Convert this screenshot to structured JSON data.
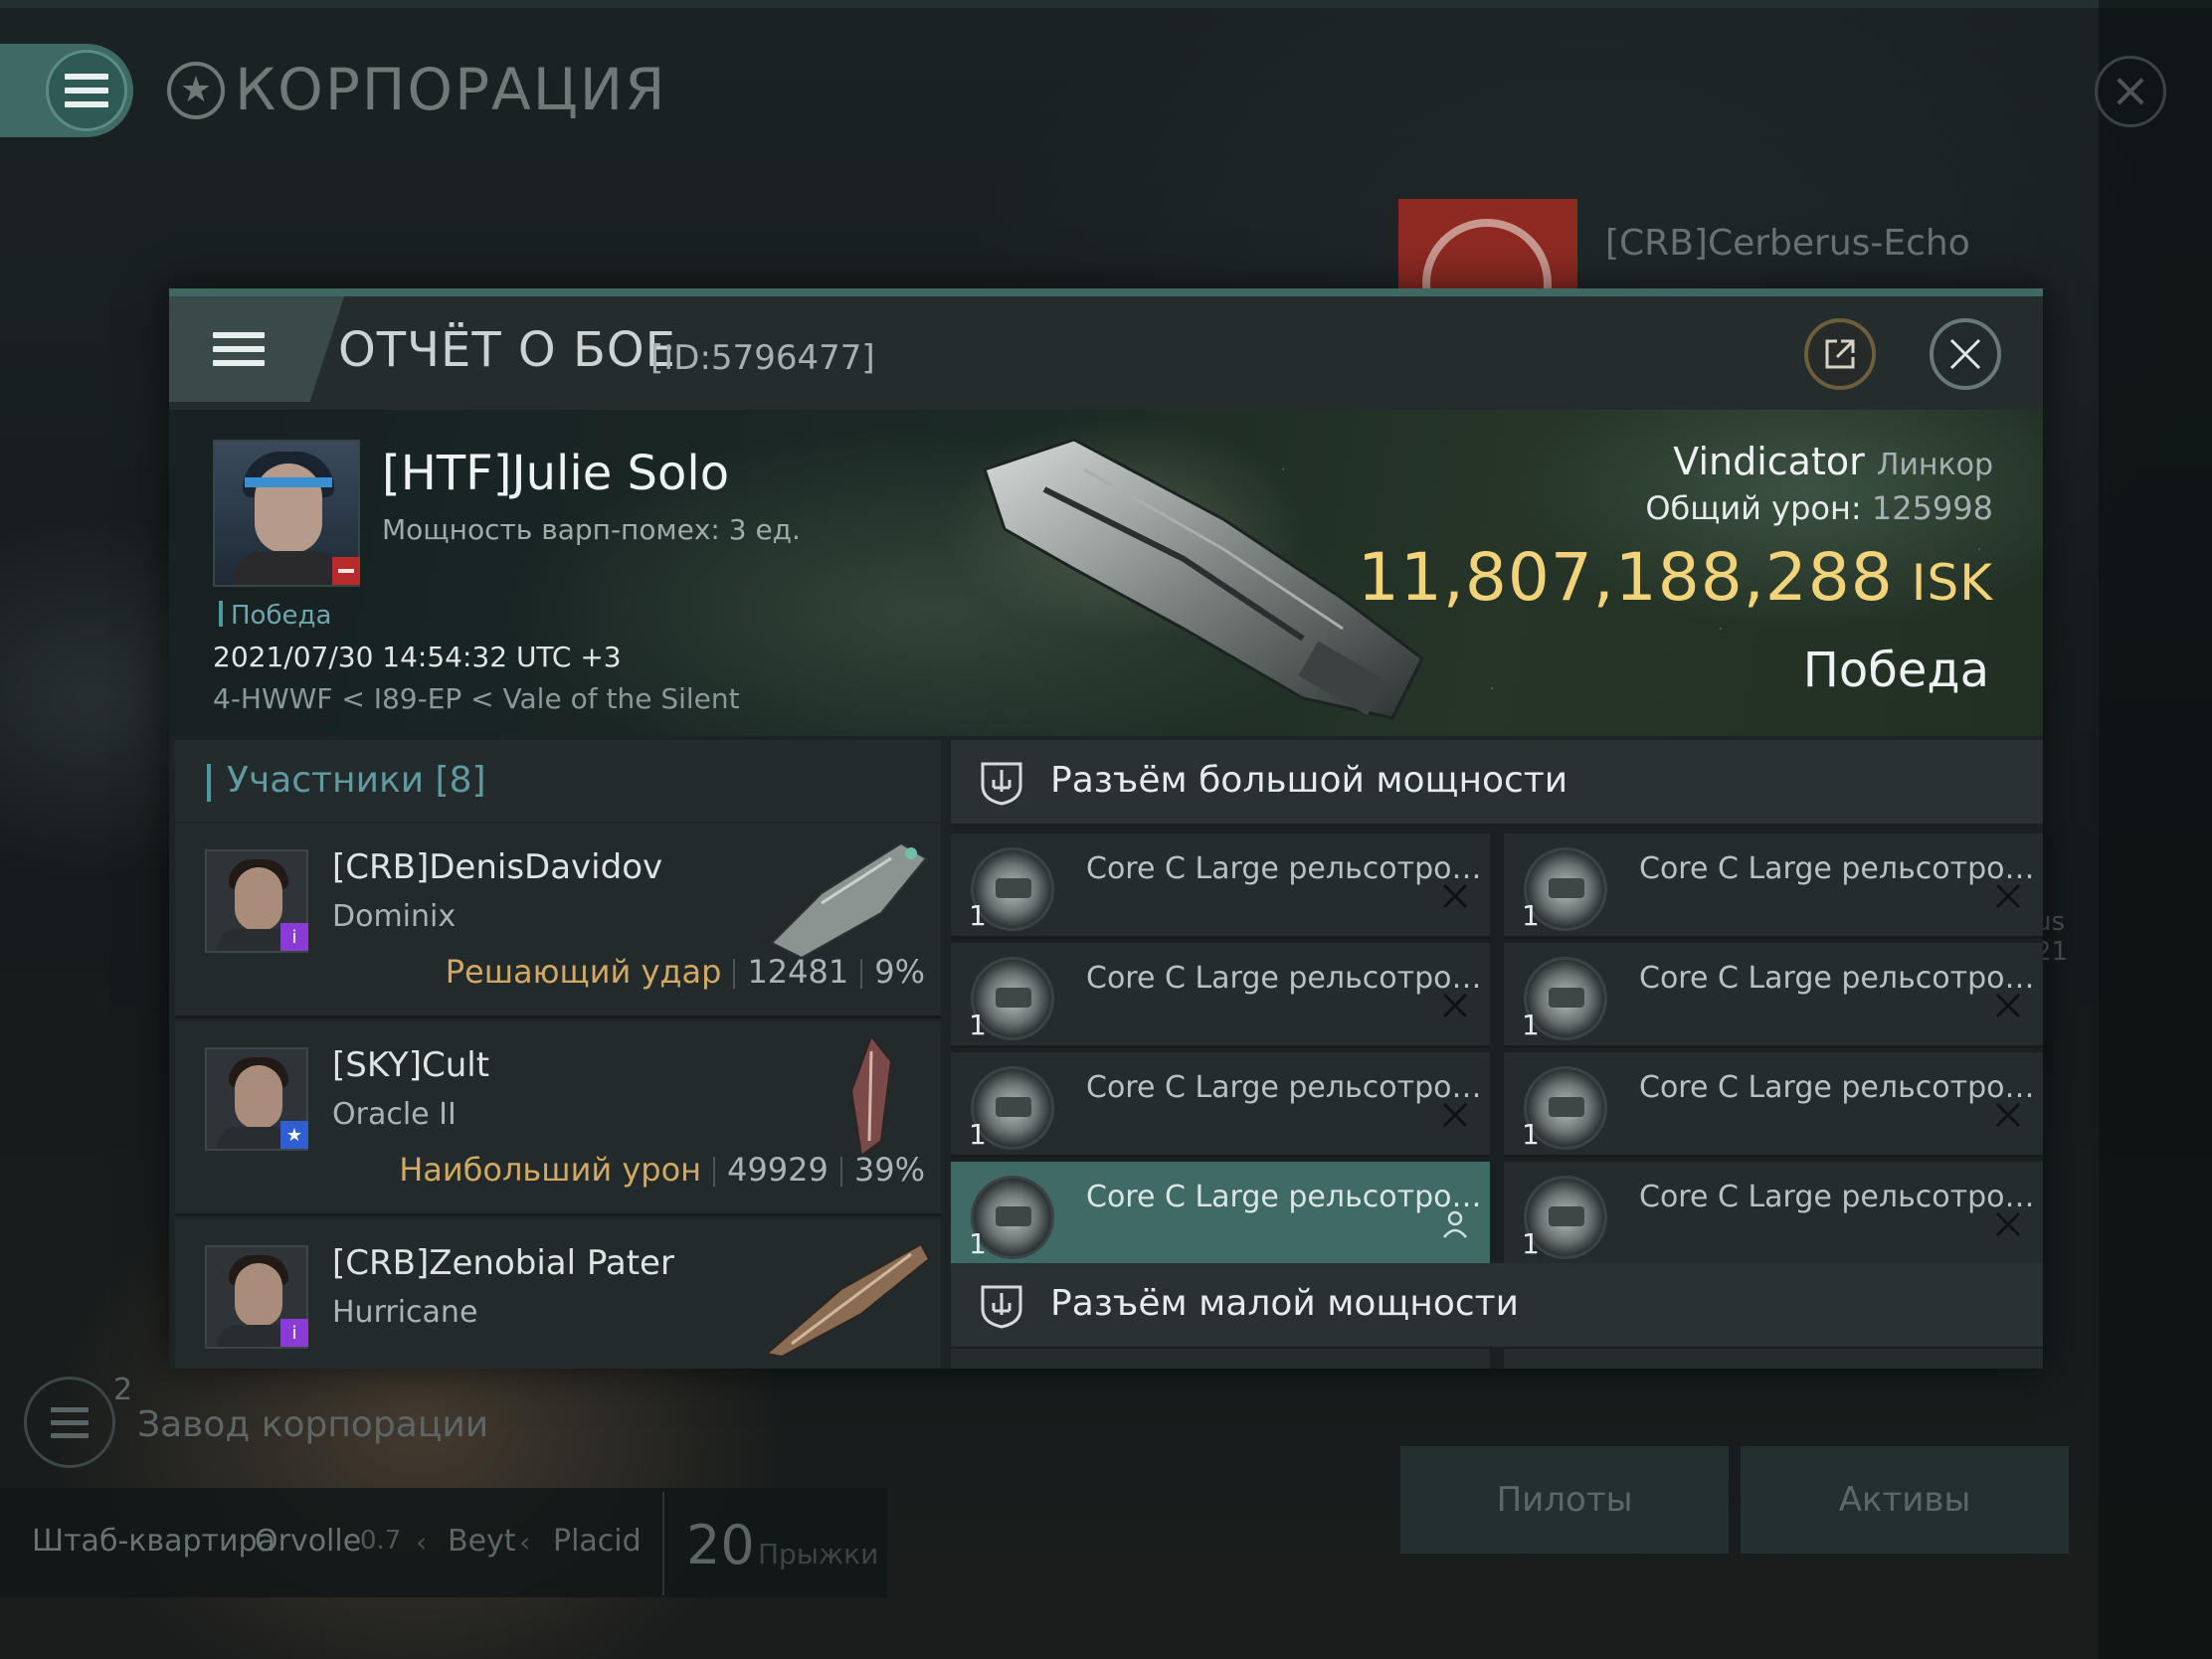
{
  "background": {
    "title": "КОРПОРАЦИЯ",
    "corp_name": "[CRB]Cerberus-Echo",
    "factory_count": "2",
    "factory_label": "Завод корпорации",
    "hq": {
      "label": "Штаб-квартира",
      "system": "Orvolle",
      "security": "0.7",
      "region1": "Beyt",
      "region2": "Placid",
      "jumps": "20",
      "jumps_label": "Прыжки"
    },
    "buttons": {
      "pilots": "Пилоты",
      "assets": "Активы"
    },
    "side_text": "us\n21"
  },
  "modal": {
    "title": "ОТЧЁТ О БОЕ",
    "report_id": "[ID:5796477]"
  },
  "victim": {
    "name": "[HTF]Julie Solo",
    "warp_scramble": "Мощность варп-помех: 3 ед.",
    "status": "Победа",
    "datetime": "2021/07/30 14:54:32 UTC +3",
    "location": "4-HWWF < I89-EP < Vale of the Silent",
    "ship": "Vindicator",
    "ship_class": "Линкор",
    "damage_label": "Общий урон:",
    "damage_value": "125998",
    "isk_value": "11,807,188,288",
    "isk_unit": "ISK",
    "result": "Победа"
  },
  "participants": {
    "title": "Участники [8]",
    "rows": [
      {
        "name": "[CRB]DenisDavidov",
        "ship": "Dominix",
        "tag": "Решающий удар",
        "damage": "12481",
        "percent": "9%",
        "badge": "purple"
      },
      {
        "name": "[SKY]Cult",
        "ship": "Oracle II",
        "tag": "Наибольший урон",
        "damage": "49929",
        "percent": "39%",
        "badge": "blue"
      },
      {
        "name": "[CRB]Zenobial Pater",
        "ship": "Hurricane",
        "tag": "",
        "damage": "",
        "percent": "",
        "badge": "purple"
      }
    ]
  },
  "fitting": {
    "high_slots_title": "Разъём большой мощности",
    "low_slots_title": "Разъём малой мощности",
    "high_modules": [
      {
        "name": "Core C Large рельсотрон с...",
        "qty": "1"
      },
      {
        "name": "Core C Large рельсотрон с...",
        "qty": "1"
      },
      {
        "name": "Core C Large рельсотрон с...",
        "qty": "1"
      },
      {
        "name": "Core C Large рельсотрон с...",
        "qty": "1"
      },
      {
        "name": "Core C Large рельсотрон с...",
        "qty": "1"
      },
      {
        "name": "Core C Large рельсотрон с...",
        "qty": "1"
      },
      {
        "name": "Core C Large рельсотрон с...",
        "qty": "1"
      },
      {
        "name": "Core C Large рельсотрон с...",
        "qty": "1"
      }
    ],
    "selected_module_index": 6
  },
  "colors": {
    "accent": "#3f6a65",
    "isk": "#f2d37a",
    "tag": "#d1a962",
    "victim_badge": "#b92a2a"
  }
}
